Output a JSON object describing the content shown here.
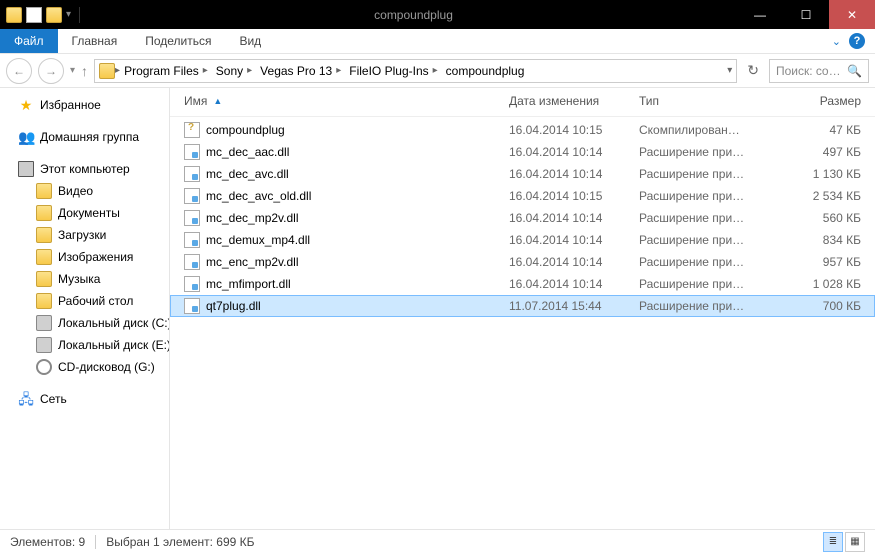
{
  "window": {
    "title": "compoundplug"
  },
  "ribbon": {
    "file": "Файл",
    "tabs": [
      "Главная",
      "Поделиться",
      "Вид"
    ]
  },
  "breadcrumbs": [
    "Program Files",
    "Sony",
    "Vegas Pro 13",
    "FileIO Plug-Ins",
    "compoundplug"
  ],
  "search": {
    "placeholder": "Поиск: co…"
  },
  "tree": {
    "favorites": "Избранное",
    "homegroup": "Домашняя группа",
    "computer": "Этот компьютер",
    "network": "Сеть",
    "computer_items": [
      {
        "label": "Видео",
        "kind": "folder"
      },
      {
        "label": "Документы",
        "kind": "folder"
      },
      {
        "label": "Загрузки",
        "kind": "folder"
      },
      {
        "label": "Изображения",
        "kind": "folder"
      },
      {
        "label": "Музыка",
        "kind": "folder"
      },
      {
        "label": "Рабочий стол",
        "kind": "folder"
      },
      {
        "label": "Локальный диск (C:)",
        "kind": "drive"
      },
      {
        "label": "Локальный диск (E:)",
        "kind": "drive"
      },
      {
        "label": "CD-дисковод (G:)",
        "kind": "disc"
      }
    ]
  },
  "columns": {
    "name": "Имя",
    "date": "Дата изменения",
    "type": "Тип",
    "size": "Размер"
  },
  "files": [
    {
      "name": "compoundplug",
      "date": "16.04.2014 10:15",
      "type": "Скомпилирован…",
      "size": "47 КБ",
      "icon": "chm",
      "selected": false
    },
    {
      "name": "mc_dec_aac.dll",
      "date": "16.04.2014 10:14",
      "type": "Расширение при…",
      "size": "497 КБ",
      "icon": "dll",
      "selected": false
    },
    {
      "name": "mc_dec_avc.dll",
      "date": "16.04.2014 10:14",
      "type": "Расширение при…",
      "size": "1 130 КБ",
      "icon": "dll",
      "selected": false
    },
    {
      "name": "mc_dec_avc_old.dll",
      "date": "16.04.2014 10:15",
      "type": "Расширение при…",
      "size": "2 534 КБ",
      "icon": "dll",
      "selected": false
    },
    {
      "name": "mc_dec_mp2v.dll",
      "date": "16.04.2014 10:14",
      "type": "Расширение при…",
      "size": "560 КБ",
      "icon": "dll",
      "selected": false
    },
    {
      "name": "mc_demux_mp4.dll",
      "date": "16.04.2014 10:14",
      "type": "Расширение при…",
      "size": "834 КБ",
      "icon": "dll",
      "selected": false
    },
    {
      "name": "mc_enc_mp2v.dll",
      "date": "16.04.2014 10:14",
      "type": "Расширение при…",
      "size": "957 КБ",
      "icon": "dll",
      "selected": false
    },
    {
      "name": "mc_mfimport.dll",
      "date": "16.04.2014 10:14",
      "type": "Расширение при…",
      "size": "1 028 КБ",
      "icon": "dll",
      "selected": false
    },
    {
      "name": "qt7plug.dll",
      "date": "11.07.2014 15:44",
      "type": "Расширение при…",
      "size": "700 КБ",
      "icon": "dll",
      "selected": true
    }
  ],
  "status": {
    "count": "Элементов: 9",
    "selection": "Выбран 1 элемент: 699 КБ"
  }
}
